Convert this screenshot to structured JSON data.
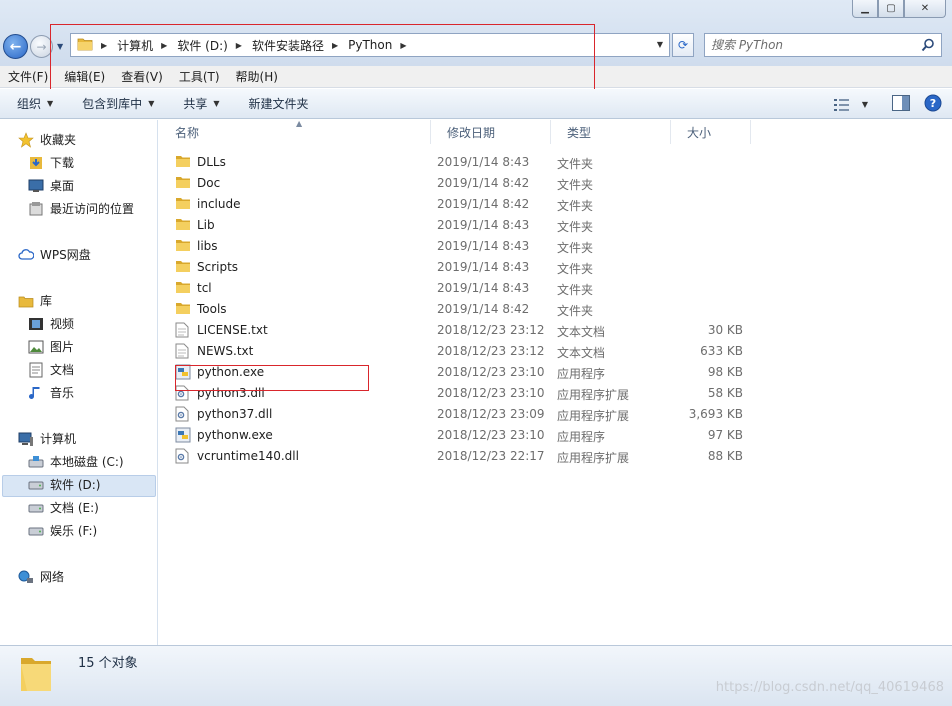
{
  "address": {
    "crumbs": [
      "计算机",
      "软件 (D:)",
      "软件安装路径",
      "PyThon"
    ],
    "search_placeholder": "搜索 PyThon"
  },
  "menu": [
    "文件(F)",
    "编辑(E)",
    "查看(V)",
    "工具(T)",
    "帮助(H)"
  ],
  "commands": [
    {
      "label": "组织",
      "dropdown": true
    },
    {
      "label": "包含到库中",
      "dropdown": true
    },
    {
      "label": "共享",
      "dropdown": true
    },
    {
      "label": "新建文件夹",
      "dropdown": false
    }
  ],
  "sidebar": {
    "favorites": {
      "label": "收藏夹",
      "items": [
        "下载",
        "桌面",
        "最近访问的位置"
      ]
    },
    "wps": {
      "label": "WPS网盘"
    },
    "libraries": {
      "label": "库",
      "items": [
        "视频",
        "图片",
        "文档",
        "音乐"
      ]
    },
    "computer": {
      "label": "计算机",
      "items": [
        "本地磁盘 (C:)",
        "软件 (D:)",
        "文档 (E:)",
        "娱乐 (F:)"
      ]
    },
    "network": {
      "label": "网络"
    }
  },
  "columns": {
    "name": "名称",
    "date": "修改日期",
    "type": "类型",
    "size": "大小"
  },
  "files": [
    {
      "name": "DLLs",
      "date": "2019/1/14 8:43",
      "type": "文件夹",
      "size": "",
      "kind": "folder"
    },
    {
      "name": "Doc",
      "date": "2019/1/14 8:42",
      "type": "文件夹",
      "size": "",
      "kind": "folder"
    },
    {
      "name": "include",
      "date": "2019/1/14 8:42",
      "type": "文件夹",
      "size": "",
      "kind": "folder"
    },
    {
      "name": "Lib",
      "date": "2019/1/14 8:43",
      "type": "文件夹",
      "size": "",
      "kind": "folder"
    },
    {
      "name": "libs",
      "date": "2019/1/14 8:43",
      "type": "文件夹",
      "size": "",
      "kind": "folder"
    },
    {
      "name": "Scripts",
      "date": "2019/1/14 8:43",
      "type": "文件夹",
      "size": "",
      "kind": "folder"
    },
    {
      "name": "tcl",
      "date": "2019/1/14 8:43",
      "type": "文件夹",
      "size": "",
      "kind": "folder"
    },
    {
      "name": "Tools",
      "date": "2019/1/14 8:42",
      "type": "文件夹",
      "size": "",
      "kind": "folder"
    },
    {
      "name": "LICENSE.txt",
      "date": "2018/12/23 23:12",
      "type": "文本文档",
      "size": "30 KB",
      "kind": "text"
    },
    {
      "name": "NEWS.txt",
      "date": "2018/12/23 23:12",
      "type": "文本文档",
      "size": "633 KB",
      "kind": "text"
    },
    {
      "name": "python.exe",
      "date": "2018/12/23 23:10",
      "type": "应用程序",
      "size": "98 KB",
      "kind": "exe"
    },
    {
      "name": "python3.dll",
      "date": "2018/12/23 23:10",
      "type": "应用程序扩展",
      "size": "58 KB",
      "kind": "dll"
    },
    {
      "name": "python37.dll",
      "date": "2018/12/23 23:09",
      "type": "应用程序扩展",
      "size": "3,693 KB",
      "kind": "dll"
    },
    {
      "name": "pythonw.exe",
      "date": "2018/12/23 23:10",
      "type": "应用程序",
      "size": "97 KB",
      "kind": "exe"
    },
    {
      "name": "vcruntime140.dll",
      "date": "2018/12/23 22:17",
      "type": "应用程序扩展",
      "size": "88 KB",
      "kind": "dll"
    }
  ],
  "status": {
    "count_text": "15 个对象"
  },
  "watermark": "https://blog.csdn.net/qq_40619468",
  "colors": {
    "highlight_box": "#d9262c",
    "accent": "#2a67c7",
    "selected_bg": "#d9e6f5"
  }
}
